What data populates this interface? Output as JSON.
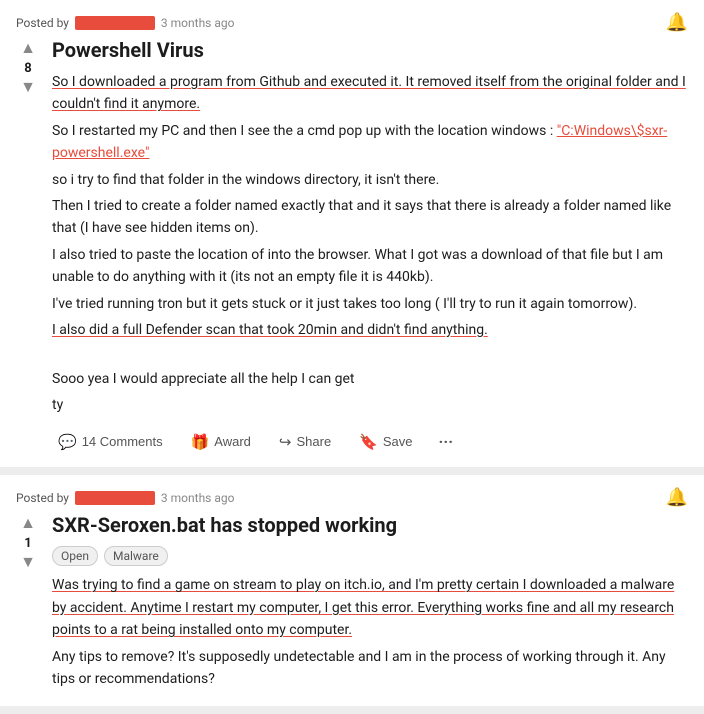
{
  "posts": [
    {
      "id": "post-1",
      "posted_by_label": "Posted by",
      "username_hidden": true,
      "time_ago": "3 months ago",
      "vote_count": "8",
      "title": "Powershell Virus",
      "flairs": [],
      "body_paragraphs": [
        {
          "text": "So I downloaded a program from Github and executed it. It removed itself from the original folder and I couldn't find it anymore.",
          "highlight": true
        },
        {
          "text": "So I restarted my PC and then I see the a cmd pop up with the location windows : \"C:Windows\\$sxr-powershell.exe\"",
          "highlight": false,
          "has_code": true,
          "code_text": "\"C:Windows\\$sxr-powershell.exe\""
        },
        {
          "text": "so i try to find that folder in the windows directory, it isn't there.",
          "highlight": false
        },
        {
          "text": "Then I tried to create a folder named exactly that and it says that there is already a folder named like that (I have see hidden items on).",
          "highlight": false
        },
        {
          "text": "I also tried to paste the location of into the browser. What I got was a download of that file but I am unable to do anything with it (its not an empty file it is 440kb).",
          "highlight": false
        },
        {
          "text": "I've tried running tron but it gets stuck or it just takes too long ( I'll try to run it again tomorrow).",
          "highlight": false
        },
        {
          "text": "I also did a full Defender scan that took 20min and didn't find anything.",
          "highlight": true
        }
      ],
      "closing_lines": [
        "Sooo yea I would appreciate all the help I can get",
        "ty"
      ],
      "footer": {
        "comments_label": "14 Comments",
        "award_label": "Award",
        "share_label": "Share",
        "save_label": "Save"
      }
    },
    {
      "id": "post-2",
      "posted_by_label": "Posted by",
      "username_hidden": true,
      "time_ago": "3 months ago",
      "vote_count": "1",
      "title": "SXR-Seroxen.bat has stopped working",
      "flairs": [
        "Open",
        "Malware"
      ],
      "body_paragraphs": [
        {
          "text": "Was trying to find a game on stream to play on itch.io, and I'm pretty certain I downloaded a malware by accident. Anytime I restart my computer, I get this error. Everything works fine and all my research points to a rat being installed onto my computer.",
          "highlight": true
        },
        {
          "text": "Any tips to remove? It's supposedly undetectable and I am in the process of working through it. Any tips or recommendations?",
          "highlight": false
        }
      ],
      "closing_lines": [],
      "footer": {
        "comments_label": "",
        "award_label": "",
        "share_label": "",
        "save_label": ""
      }
    }
  ],
  "icons": {
    "upvote": "▲",
    "downvote": "▼",
    "comments": "💬",
    "award": "🎁",
    "share": "↪",
    "save": "🔖",
    "bell": "🔔"
  }
}
